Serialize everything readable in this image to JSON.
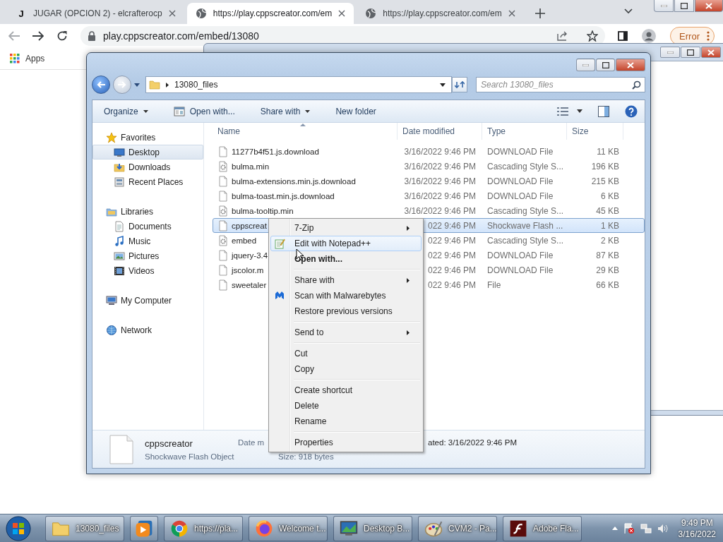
{
  "browser": {
    "tabs": [
      {
        "favicon": "J",
        "title": "JUGAR (OPCION 2) - elcrafterocp",
        "selected": false
      },
      {
        "title": "https://play.cppscreator.com/em",
        "selected": true
      },
      {
        "title": "https://play.cppscreator.com/em",
        "selected": false
      }
    ],
    "address": "play.cppscreator.com/embed/13080",
    "profile_button": "Error",
    "bookmarks": [
      "Apps"
    ]
  },
  "explorer": {
    "breadcrumb": "13080_files",
    "search": {
      "placeholder": "Search 13080_files"
    },
    "toolbar": [
      {
        "label": "Organize",
        "dropdown": true
      },
      {
        "label": "Open with...",
        "dropdown": false
      },
      {
        "label": "Share with",
        "dropdown": true
      },
      {
        "label": "New folder",
        "dropdown": false
      }
    ],
    "nav": [
      {
        "label": "Favorites",
        "selected": false,
        "children": [
          {
            "label": "Desktop",
            "selected": true
          },
          {
            "label": "Downloads",
            "selected": false
          },
          {
            "label": "Recent Places",
            "selected": false
          }
        ]
      },
      {
        "label": "Libraries",
        "selected": false,
        "children": [
          {
            "label": "Documents",
            "selected": false
          },
          {
            "label": "Music",
            "selected": false
          },
          {
            "label": "Pictures",
            "selected": false
          },
          {
            "label": "Videos",
            "selected": false
          }
        ]
      },
      {
        "label": "My Computer",
        "selected": false
      },
      {
        "label": "Network",
        "selected": false
      }
    ],
    "columns": [
      "Name",
      "Date modified",
      "Type",
      "Size"
    ],
    "rows": [
      {
        "name": "11277b4f51.js.download",
        "date": "3/16/2022 9:46 PM",
        "type": "DOWNLOAD File",
        "size": "11 KB",
        "selected": false
      },
      {
        "name": "bulma.min",
        "date": "3/16/2022 9:46 PM",
        "type": "Cascading Style S...",
        "size": "196 KB",
        "selected": false
      },
      {
        "name": "bulma-extensions.min.js.download",
        "date": "3/16/2022 9:46 PM",
        "type": "DOWNLOAD File",
        "size": "215 KB",
        "selected": false
      },
      {
        "name": "bulma-toast.min.js.download",
        "date": "3/16/2022 9:46 PM",
        "type": "DOWNLOAD File",
        "size": "6 KB",
        "selected": false
      },
      {
        "name": "bulma-tooltip.min",
        "date": "3/16/2022 9:46 PM",
        "type": "Cascading Style S...",
        "size": "45 KB",
        "selected": false
      },
      {
        "name": "cppscreat",
        "date": "022 9:46 PM",
        "type": "Shockwave Flash ...",
        "size": "1 KB",
        "selected": true
      },
      {
        "name": "embed",
        "date": "022 9:46 PM",
        "type": "Cascading Style S...",
        "size": "2 KB",
        "selected": false
      },
      {
        "name": "jquery-3.4",
        "date": "022 9:46 PM",
        "type": "DOWNLOAD File",
        "size": "87 KB",
        "selected": false
      },
      {
        "name": "jscolor.m",
        "date": "022 9:46 PM",
        "type": "DOWNLOAD File",
        "size": "29 KB",
        "selected": false
      },
      {
        "name": "sweetaler",
        "date": "022 9:46 PM",
        "type": "File",
        "size": "66 KB",
        "selected": false
      }
    ],
    "details": {
      "name": "cppscreator",
      "type": "Shockwave Flash Object",
      "date_label": "Date m",
      "created": "ated: 3/16/2022 9:46 PM",
      "size": "Size: 918 bytes"
    }
  },
  "context_menu": [
    {
      "kind": "item",
      "label": "7-Zip",
      "submenu": true,
      "bold": false,
      "selected": false
    },
    {
      "kind": "item",
      "label": "Edit with Notepad++",
      "submenu": false,
      "bold": false,
      "selected": true
    },
    {
      "kind": "item",
      "label": "Open with...",
      "submenu": false,
      "bold": true,
      "selected": false
    },
    {
      "kind": "separator"
    },
    {
      "kind": "item",
      "label": "Share with",
      "submenu": true,
      "bold": false,
      "selected": false
    },
    {
      "kind": "item",
      "label": "Scan with Malwarebytes",
      "submenu": false,
      "bold": false,
      "selected": false
    },
    {
      "kind": "item",
      "label": "Restore previous versions",
      "submenu": false,
      "bold": false,
      "selected": false
    },
    {
      "kind": "separator"
    },
    {
      "kind": "item",
      "label": "Send to",
      "submenu": true,
      "bold": false,
      "selected": false
    },
    {
      "kind": "separator"
    },
    {
      "kind": "item",
      "label": "Cut",
      "submenu": false,
      "bold": false,
      "selected": false
    },
    {
      "kind": "item",
      "label": "Copy",
      "submenu": false,
      "bold": false,
      "selected": false
    },
    {
      "kind": "separator"
    },
    {
      "kind": "item",
      "label": "Create shortcut",
      "submenu": false,
      "bold": false,
      "selected": false
    },
    {
      "kind": "item",
      "label": "Delete",
      "submenu": false,
      "bold": false,
      "selected": false
    },
    {
      "kind": "item",
      "label": "Rename",
      "submenu": false,
      "bold": false,
      "selected": false
    },
    {
      "kind": "separator"
    },
    {
      "kind": "item",
      "label": "Properties",
      "submenu": false,
      "bold": false,
      "selected": false
    }
  ],
  "taskbar": {
    "items": [
      {
        "label": "13080_files",
        "selected": true
      },
      {
        "selected": false
      },
      {
        "label": "https://pla...",
        "selected": false
      },
      {
        "label": "Welcome t...",
        "selected": false
      },
      {
        "label": "Desktop B...",
        "selected": false
      },
      {
        "label": "CVM2 - Pa...",
        "selected": false
      },
      {
        "label": "Adobe Fla...",
        "selected": false
      }
    ],
    "time": "9:49 PM",
    "date": "3/16/2022"
  }
}
